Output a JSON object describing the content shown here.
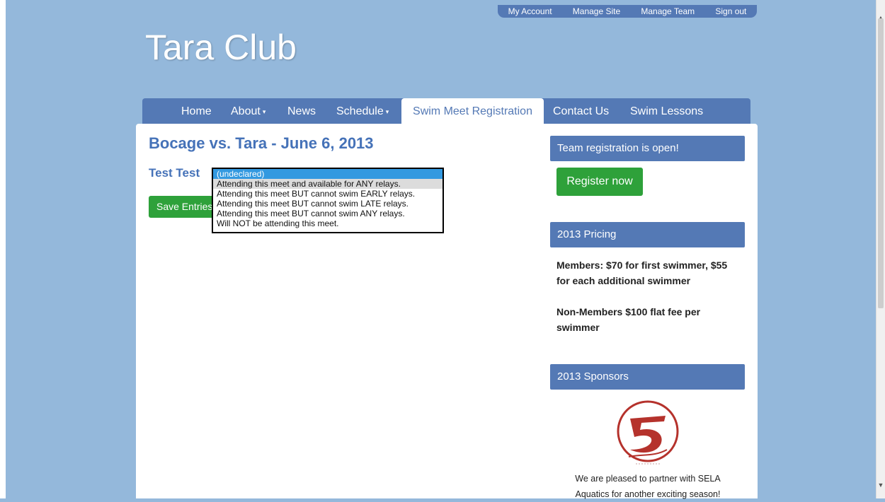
{
  "top_links": [
    "My Account",
    "Manage Site",
    "Manage Team",
    "Sign out"
  ],
  "site_title": "Tara Club",
  "nav": {
    "home": "Home",
    "about": "About",
    "news": "News",
    "schedule": "Schedule",
    "swim_meet_registration": "Swim Meet Registration",
    "contact_us": "Contact Us",
    "swim_lessons": "Swim Lessons"
  },
  "main": {
    "meet_title": "Bocage vs. Tara - June 6, 2013",
    "swimmer_name": "Test Test",
    "save_button": "Save Entries",
    "dropdown_options": [
      "(undeclared)",
      "Attending this meet and available for ANY relays.",
      "Attending this meet BUT cannot swim EARLY relays.",
      "Attending this meet BUT cannot swim LATE relays.",
      "Attending this meet BUT cannot swim ANY relays.",
      "Will NOT be attending this meet."
    ],
    "selected_option": "(undeclared)",
    "hovered_option": "Attending this meet and available for ANY relays."
  },
  "sidebar": {
    "registration_header": "Team registration is open!",
    "register_button": "Register now",
    "pricing_header": "2013 Pricing",
    "pricing_members": "Members: $70 for first swimmer, $55 for each additional swimmer",
    "pricing_nonmembers": "Non-Members $100 flat fee per swimmer",
    "sponsors_header": "2013 Sponsors",
    "sponsor_text": "We are pleased to partner with SELA Aquatics for another exciting season!"
  },
  "icons": {
    "dropdown_caret": "caret-down-icon",
    "sponsor_logo": "sela-aquatics-logo",
    "scroll_up": "scroll-up-arrow",
    "scroll_down": "scroll-down-arrow"
  },
  "colors": {
    "page_background": "#94b8db",
    "nav_blue": "#5479b5",
    "heading_blue": "#4572b8",
    "button_green": "#2ea13a",
    "selected_option": "#3399e0",
    "logo_red": "#b5322c"
  }
}
